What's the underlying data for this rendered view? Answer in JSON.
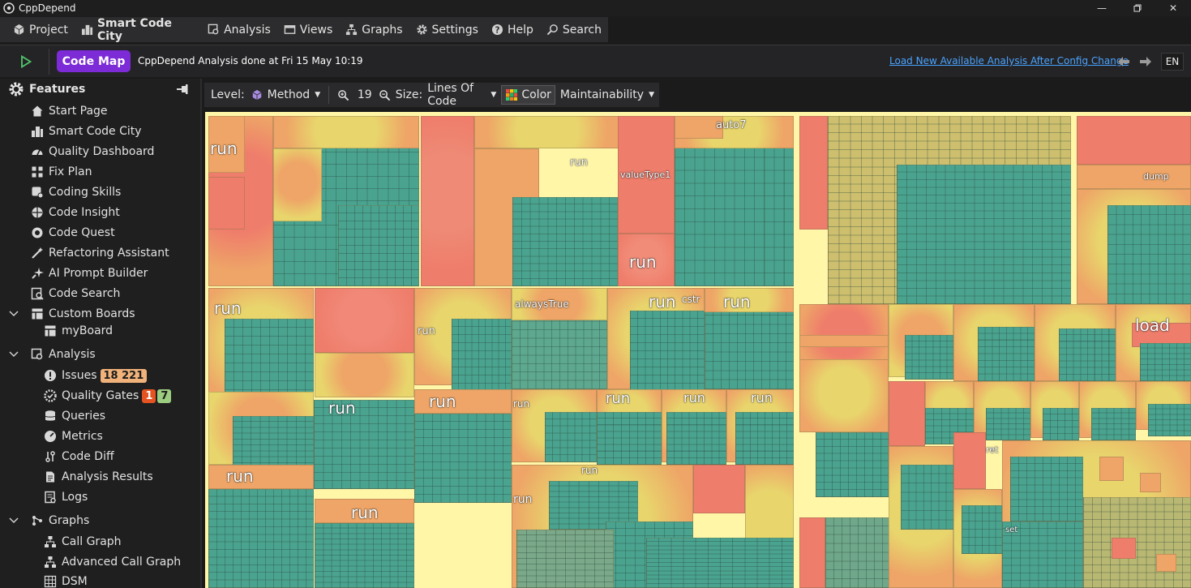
{
  "window": {
    "title": "CppDepend",
    "controls": [
      "minimize-icon",
      "maximize-icon",
      "close-icon"
    ]
  },
  "menu": [
    {
      "label": "Project",
      "icon": "cube-icon"
    },
    {
      "label": "Smart Code City",
      "icon": "city-icon"
    },
    {
      "label": "Analysis",
      "icon": "analysis-icon"
    },
    {
      "label": "Views",
      "icon": "views-icon"
    },
    {
      "label": "Graphs",
      "icon": "graph-icon"
    },
    {
      "label": "Settings",
      "icon": "gear-icon"
    },
    {
      "label": "Help",
      "icon": "help-icon"
    },
    {
      "label": "Search",
      "icon": "search-icon"
    }
  ],
  "notification": {
    "code_map_label": "Code Map",
    "message": "CppDepend Analysis done at Fri 15 May  10:19",
    "link": "Load New Available Analysis After Config Change",
    "language": "EN"
  },
  "sidebar": {
    "title": "Features",
    "items": [
      {
        "label": "Start Page",
        "icon": "home-icon"
      },
      {
        "label": "Smart Code City",
        "icon": "city-icon"
      },
      {
        "label": "Quality Dashboard",
        "icon": "dashboard-icon"
      },
      {
        "label": "Fix Plan",
        "icon": "plan-icon"
      },
      {
        "label": "Coding Skills",
        "icon": "skills-icon"
      },
      {
        "label": "Code Insight",
        "icon": "insight-icon"
      },
      {
        "label": "Code Quest",
        "icon": "quest-icon"
      },
      {
        "label": "Refactoring Assistant",
        "icon": "wand-icon"
      },
      {
        "label": "AI Prompt Builder",
        "icon": "sparkle-icon"
      },
      {
        "label": "Code Search",
        "icon": "code-search-icon"
      },
      {
        "label": "Custom Boards",
        "icon": "board-icon"
      },
      {
        "label": "myBoard",
        "icon": "board-icon"
      },
      {
        "label": "Analysis",
        "icon": "analysis-icon"
      },
      {
        "label": "Issues",
        "icon": "alert-icon",
        "badge": "18 221"
      },
      {
        "label": "Quality Gates",
        "icon": "shield-check-icon",
        "badge_red": "1",
        "badge_green": "7"
      },
      {
        "label": "Queries",
        "icon": "database-icon"
      },
      {
        "label": "Metrics",
        "icon": "metrics-icon"
      },
      {
        "label": "Code Diff",
        "icon": "diff-icon"
      },
      {
        "label": "Analysis Results",
        "icon": "document-icon"
      },
      {
        "label": "Logs",
        "icon": "logs-icon"
      },
      {
        "label": "Graphs",
        "icon": "graph-icon"
      },
      {
        "label": "Call Graph",
        "icon": "hierarchy-icon"
      },
      {
        "label": "Advanced Call Graph",
        "icon": "hierarchy-icon"
      },
      {
        "label": "DSM",
        "icon": "matrix-icon"
      }
    ]
  },
  "toolbar": {
    "level_label": "Level:",
    "level_value": "Method",
    "zoom_value": "19",
    "size_label": "Size:",
    "size_value": "Lines Of Code",
    "color_label": "Color",
    "color_value": "Maintainability"
  },
  "treemap": {
    "colors": {
      "red": "#ef7d6b",
      "orange": "#eea567",
      "yellow": "#e8d66c",
      "olive": "#b8c071",
      "teal": "#4aa38f",
      "border": "#fff6a8"
    },
    "labels": [
      "run",
      "auto7",
      "run",
      "valueType1",
      "run",
      "run",
      "alwaysTrue",
      "run",
      "cstr",
      "run",
      "run",
      "run",
      "run",
      "run",
      "run",
      "run",
      "run",
      "run",
      "run",
      "run",
      "run",
      "dump",
      "load",
      "ret",
      "set"
    ]
  }
}
